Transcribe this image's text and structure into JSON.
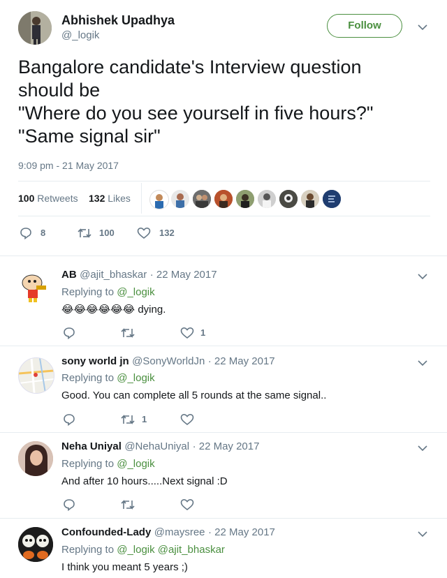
{
  "tweet": {
    "author_name": "Abhishek Upadhya",
    "author_handle": "@_logik",
    "follow_label": "Follow",
    "text_lines": [
      "Bangalore candidate's Interview question",
      "should be",
      "\"Where do you see yourself in five hours?\"",
      "\"Same signal sir\""
    ],
    "timestamp": "9:09 pm - 21 May 2017",
    "retweets_count": "100",
    "retweets_label": "Retweets",
    "likes_count": "132",
    "likes_label": "Likes",
    "reply_count": "8",
    "retweet_count": "100",
    "like_count": "132"
  },
  "replies": [
    {
      "name": "AB",
      "handle": "@ajit_bhaskar",
      "date": "· 22 May 2017",
      "replying_prefix": "Replying to",
      "replying_to": "@_logik",
      "text": "😂😂😂😂😂😂 dying.",
      "like_count": "1",
      "retweet_count": "",
      "reply_count": ""
    },
    {
      "name": "sony world jn",
      "handle": "@SonyWorldJn",
      "date": "· 22 May 2017",
      "replying_prefix": "Replying to",
      "replying_to": "@_logik",
      "text": "Good. You can complete all 5 rounds at the same signal..",
      "like_count": "",
      "retweet_count": "1",
      "reply_count": ""
    },
    {
      "name": "Neha Uniyal",
      "handle": "@NehaUniyal",
      "date": "· 22 May 2017",
      "replying_prefix": "Replying to",
      "replying_to": "@_logik",
      "text": "And after 10 hours.....Next signal :D",
      "like_count": "",
      "retweet_count": "",
      "reply_count": ""
    },
    {
      "name": "Confounded-Lady",
      "handle": "@maysree",
      "date": "· 22 May 2017",
      "replying_prefix": "Replying to",
      "replying_to": "@_logik @ajit_bhaskar",
      "text": "I think you meant 5 years ;)",
      "like_count": "",
      "retweet_count": "",
      "reply_count": ""
    }
  ],
  "colors": {
    "accent": "#1da1f2",
    "follow_border": "#4a8f3f",
    "replying_link": "#4a8f3f",
    "text": "#14171a",
    "muted": "#657786",
    "divider": "#e6ecf0"
  }
}
